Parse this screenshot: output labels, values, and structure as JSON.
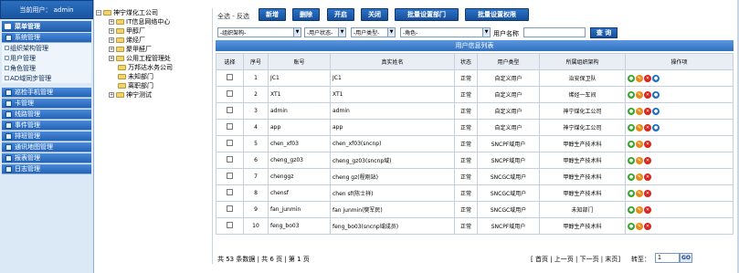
{
  "sidebar": {
    "user_label": "当前用户：",
    "user_name": "admin",
    "main_menu": "菜单管理",
    "sections": [
      "系统管理",
      "巡检手机管理",
      "卡管理",
      "线路管理",
      "事件管理",
      "排班管理",
      "通讯地图管理",
      "报表管理",
      "日志管理"
    ],
    "system_items": [
      "组织架构管理",
      "用户管理",
      "角色管理",
      "AD域同步管理"
    ]
  },
  "tree": {
    "root": "神宁煤化工公司",
    "nodes": [
      "IT信息网络中心",
      "甲醇厂",
      "烯烃厂",
      "聚甲醛厂",
      "公用工程管理处",
      "万邦达水务公司",
      "未知部门",
      "离职部门",
      "神宁测试"
    ]
  },
  "toolbar": {
    "select_label": "全选 - 反选",
    "buttons": [
      "新增",
      "删除",
      "开启",
      "关闭",
      "批量设置部门",
      "批量设置权限"
    ]
  },
  "filters": {
    "org": "-组织架构-",
    "status": "-用户状态-",
    "type": "-用户类型-",
    "role": "-角色-",
    "name_label": "用户名称",
    "search": "查 询"
  },
  "grid": {
    "title": "用户信息列表",
    "headers": [
      "选择",
      "序号",
      "账号",
      "真实姓名",
      "状态",
      "用户类型",
      "所属组织架构",
      "操作项"
    ],
    "rows": [
      {
        "no": "1",
        "account": "JC1",
        "name": "JC1",
        "status": "正常",
        "type": "自定义用户",
        "org": "治安保卫队",
        "blue": true
      },
      {
        "no": "2",
        "account": "XT1",
        "name": "XT1",
        "status": "正常",
        "type": "自定义用户",
        "org": "烯烃一车间",
        "blue": true
      },
      {
        "no": "3",
        "account": "admin",
        "name": "admin",
        "status": "正常",
        "type": "自定义用户",
        "org": "神宁煤化工公司",
        "blue": true
      },
      {
        "no": "4",
        "account": "app",
        "name": "app",
        "status": "正常",
        "type": "自定义用户",
        "org": "神宁煤化工公司",
        "blue": true
      },
      {
        "no": "5",
        "account": "chen_xf03",
        "name": "chen_xf03(sncnp)",
        "status": "正常",
        "type": "SNCPF域用户",
        "org": "甲醇生产技术科",
        "blue": false
      },
      {
        "no": "6",
        "account": "cheng_gz03",
        "name": "cheng_gz03(sncnp域)",
        "status": "正常",
        "type": "SNCPF域用户",
        "org": "甲醇生产技术科",
        "blue": false
      },
      {
        "no": "7",
        "account": "chenggz",
        "name": "cheng gz(程刚站)",
        "status": "正常",
        "type": "SNCGC域用户",
        "org": "甲醇生产技术科",
        "blue": false
      },
      {
        "no": "8",
        "account": "chensf",
        "name": "chen sf(陈士祥)",
        "status": "正常",
        "type": "SNCGC域用户",
        "org": "甲醇生产技术科",
        "blue": false
      },
      {
        "no": "9",
        "account": "fan_junmin",
        "name": "fan junmin(樊军民)",
        "status": "正常",
        "type": "SNCGC域用户",
        "org": "未知部门",
        "blue": false
      },
      {
        "no": "10",
        "account": "feng_bo03",
        "name": "feng_bo03(sncnp域成员)",
        "status": "正常",
        "type": "SNCPF域用户",
        "org": "甲醇生产技术科",
        "blue": false
      }
    ]
  },
  "pager": {
    "summary": "共 53 条数据 | 共 6 页 | 第 1 页",
    "nav": "[ 首页 | 上一页 | 下一页 | 末页]",
    "goto_label": "转至：",
    "page_value": "1",
    "go": "GO"
  }
}
